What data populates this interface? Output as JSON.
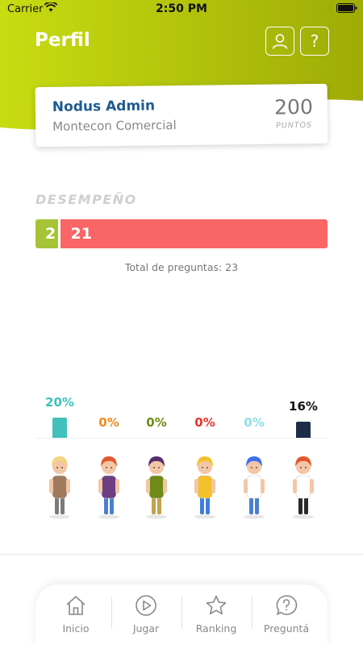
{
  "status_bar": {
    "carrier": "Carrier",
    "time": "2:50 PM"
  },
  "header": {
    "title": "Perfil",
    "help_label": "?",
    "gradient": [
      "#c8dc12",
      "#9eac05"
    ]
  },
  "profile": {
    "name": "Nodus Admin",
    "company": "Montecon Comercial",
    "points": "200",
    "points_label": "PUNTOS"
  },
  "performance": {
    "title": "DESEMPEÑO",
    "correct": "2",
    "wrong": "21",
    "correct_color": "#a6c436",
    "wrong_color": "#fa6565",
    "total_text": "Total de preguntas: 23"
  },
  "categories": [
    {
      "percent_label": "20%",
      "value": 20,
      "color": "#41c0bc",
      "character": "blonde-man"
    },
    {
      "percent_label": "0%",
      "value": 0,
      "color": "#f28a1e",
      "character": "redhead-woman"
    },
    {
      "percent_label": "0%",
      "value": 0,
      "color": "#6f8a17",
      "character": "purple-hair-woman"
    },
    {
      "percent_label": "0%",
      "value": 0,
      "color": "#e8332b",
      "character": "construction-worker"
    },
    {
      "percent_label": "0%",
      "value": 0,
      "color": "#8fe0e4",
      "character": "blue-hair-woman"
    },
    {
      "percent_label": "16%",
      "value": 16,
      "color": "#1d2c4a",
      "character": "businessman"
    }
  ],
  "tabs": [
    {
      "label": "Inicio",
      "icon": "home-icon"
    },
    {
      "label": "Jugar",
      "icon": "play-icon"
    },
    {
      "label": "Ranking",
      "icon": "star-icon"
    },
    {
      "label": "Preguntá",
      "icon": "question-bubble-icon"
    }
  ]
}
